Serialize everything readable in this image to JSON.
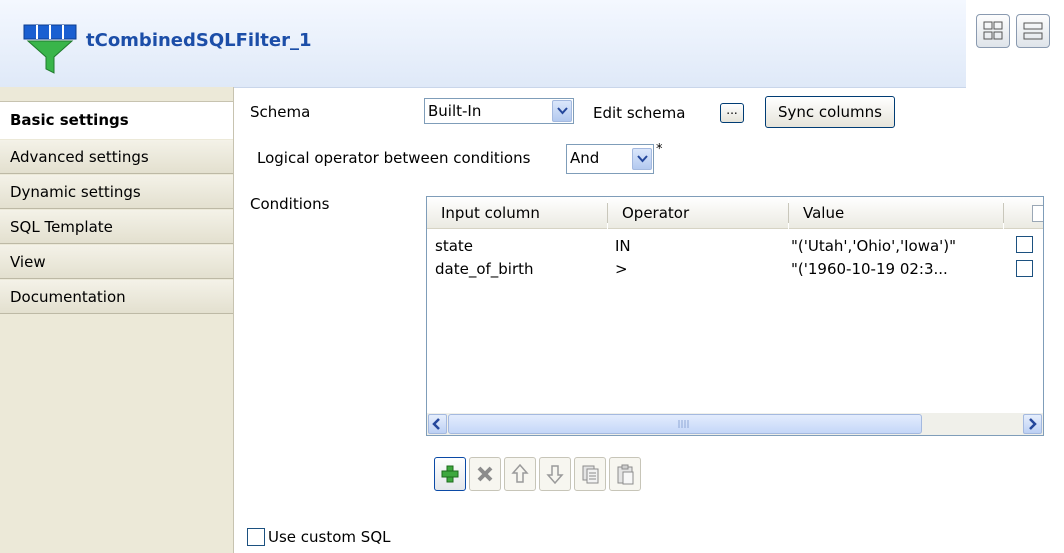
{
  "header": {
    "title": "tCombinedSQLFilter_1"
  },
  "sidebar": {
    "tabs": [
      {
        "label": "Basic settings",
        "active": true
      },
      {
        "label": "Advanced settings",
        "active": false
      },
      {
        "label": "Dynamic settings",
        "active": false
      },
      {
        "label": "SQL Template",
        "active": false
      },
      {
        "label": "View",
        "active": false
      },
      {
        "label": "Documentation",
        "active": false
      }
    ]
  },
  "form": {
    "schema_label": "Schema",
    "schema_value": "Built-In",
    "edit_schema_label": "Edit schema",
    "edit_schema_button": "...",
    "sync_columns_button": "Sync columns",
    "logical_operator_label": "Logical operator between conditions",
    "logical_operator_value": "And",
    "required_marker": "*",
    "conditions_label": "Conditions",
    "use_custom_sql_label": "Use custom SQL"
  },
  "conditions_table": {
    "columns": [
      "Input column",
      "Operator",
      "Value"
    ],
    "rows": [
      {
        "input_column": "state",
        "operator": "IN",
        "value": "\"('Utah','Ohio','Iowa')\""
      },
      {
        "input_column": "date_of_birth",
        "operator": ">",
        "value": "\"('1960-10-19 02:3..."
      }
    ]
  },
  "toolbar": {
    "icons": [
      "add-icon",
      "delete-icon",
      "move-up-icon",
      "move-down-icon",
      "copy-icon",
      "paste-icon"
    ]
  },
  "colors": {
    "title": "#1c4ea8",
    "accent": "#7f9db9"
  }
}
